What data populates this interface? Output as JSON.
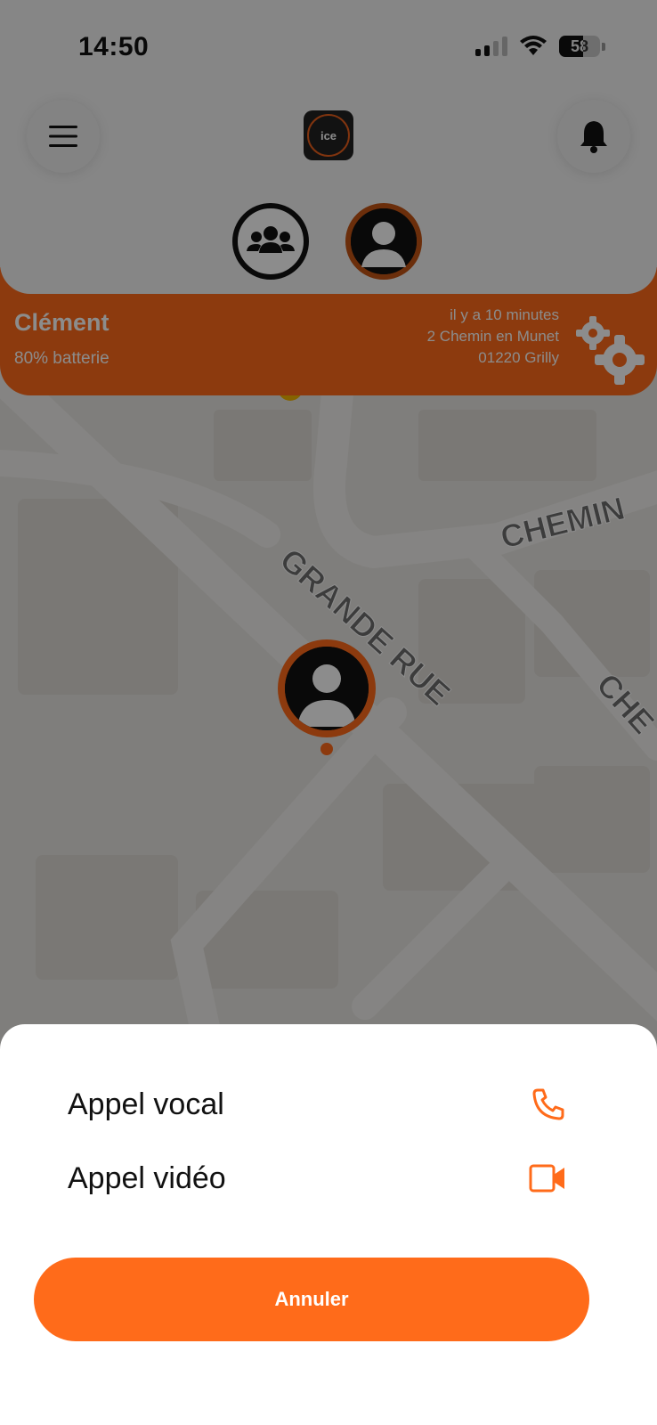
{
  "status_bar": {
    "time": "14:50",
    "battery_level": "58"
  },
  "header": {
    "logo_text": "ice",
    "menu_icon": "hamburger-menu-icon",
    "bell_icon": "bell-icon",
    "group_icon": "group-icon",
    "child_icon": "person-icon"
  },
  "child": {
    "name": "Clément",
    "battery": "80% batterie",
    "last_seen": "il y a 10 minutes",
    "address_line1": "2 Chemin en Munet",
    "address_line2": "01220 Grilly"
  },
  "map": {
    "streets": [
      "GRANDE RUE",
      "CHEMIN",
      "CHE"
    ]
  },
  "action_sheet": {
    "voice_call_label": "Appel vocal",
    "video_call_label": "Appel vidéo",
    "cancel_label": "Annuler"
  },
  "colors": {
    "accent": "#ff6b1a",
    "accent_dark": "#c45414"
  }
}
